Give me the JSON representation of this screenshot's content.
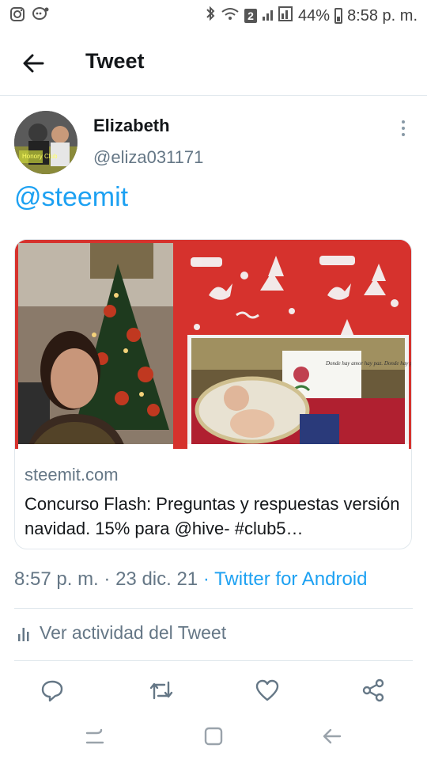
{
  "status_bar": {
    "battery": "44%",
    "time": "8:58 p. m.",
    "sim_badge": "2"
  },
  "header": {
    "title": "Tweet"
  },
  "tweet": {
    "author_name": "Elizabeth",
    "author_handle": "@eliza031171",
    "avatar_text": "Honory Club",
    "text": "@steemit",
    "card": {
      "domain": "steemit.com",
      "title": "Concurso Flash: Preguntas y respuestas versión navidad. 15% para @hive- #club5…",
      "note_text": "Donde hay amor hay paz. Donde hay paz está Dios. Donde está Dios no falta nada."
    },
    "time": "8:57 p. m.",
    "date": "23 dic. 21",
    "separator": "·",
    "source": "Twitter for Android",
    "activity_label": "Ver actividad del Tweet"
  },
  "colors": {
    "accent": "#1da1f2",
    "secondary_text": "#657786",
    "border": "#e1e8ed",
    "card_red": "#d6322d"
  },
  "icons": {
    "back": "arrow-left-icon",
    "more": "more-vertical-icon",
    "reply": "reply-icon",
    "retweet": "retweet-icon",
    "like": "heart-icon",
    "share": "share-icon",
    "activity": "bar-chart-icon"
  }
}
